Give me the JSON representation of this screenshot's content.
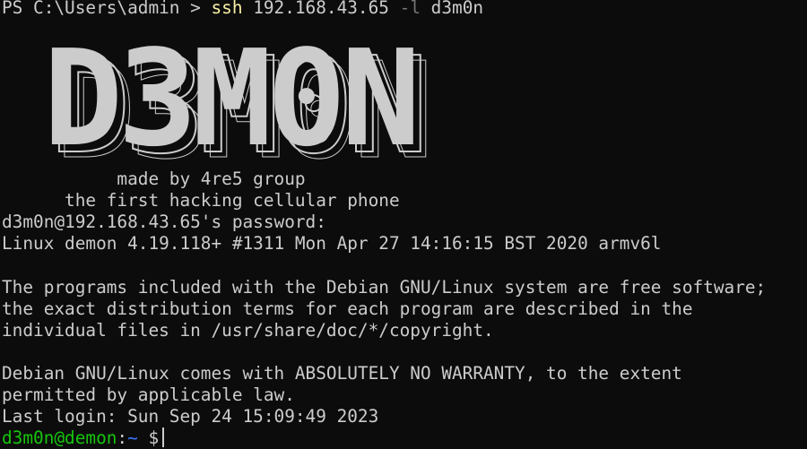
{
  "colors": {
    "background": "#0c0c0c",
    "foreground": "#cccccc",
    "command": "#f9f1a5",
    "flag": "#767676",
    "user_host": "#16c60c",
    "cwd": "#3b78ff"
  },
  "ps_line": {
    "prompt": "PS C:\\Users\\admin > ",
    "command": "ssh",
    "host_arg": " 192.168.43.65 ",
    "flag": "-l",
    "user_arg": " d3m0n"
  },
  "banner": {
    "logo_text": "D3M0N"
  },
  "lines": {
    "made_by": "           made by 4re5 group",
    "tagline": "      the first hacking cellular phone",
    "password_prompt": "d3m0n@192.168.43.65's password:",
    "uname": "Linux demon 4.19.118+ #1311 Mon Apr 27 14:16:15 BST 2020 armv6l",
    "motd1": "The programs included with the Debian GNU/Linux system are free software;",
    "motd2": "the exact distribution terms for each program are described in the",
    "motd3": "individual files in /usr/share/doc/*/copyright.",
    "motd4": "Debian GNU/Linux comes with ABSOLUTELY NO WARRANTY, to the extent",
    "motd5": "permitted by applicable law.",
    "last_login": "Last login: Sun Sep 24 15:09:49 2023"
  },
  "shell_prompt": {
    "user_host": "d3m0n@demon",
    "colon": ":",
    "cwd": "~",
    "symbol": " $"
  }
}
